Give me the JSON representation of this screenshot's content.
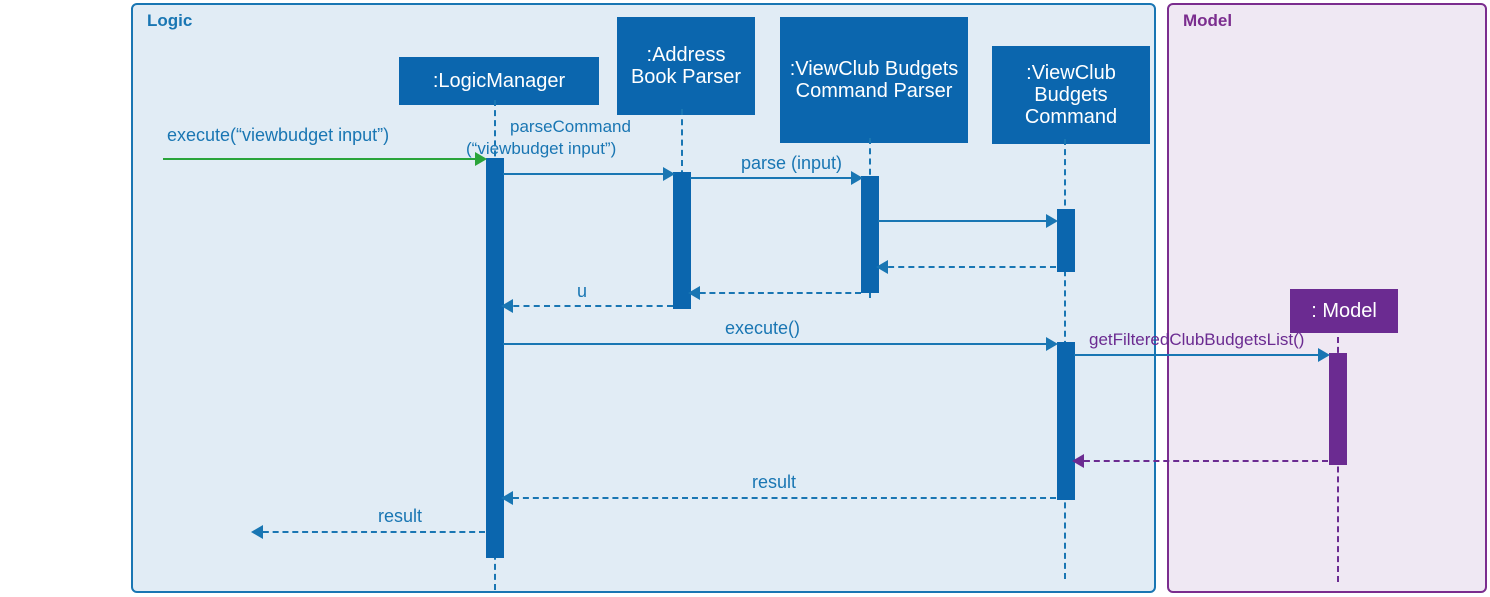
{
  "frames": {
    "logic": "Logic",
    "model": "Model"
  },
  "heads": {
    "logicManager": ":LogicManager",
    "addressBookParser": ":Address Book Parser",
    "viewClubBudgetsCommandParser": ":ViewClub Budgets Command Parser",
    "viewClubBudgetsCommand": ":ViewClub Budgets Command",
    "model": ": Model"
  },
  "messages": {
    "executeInput": "execute(“viewbudget input”)",
    "parseCommand1": "parseCommand",
    "parseCommand2": "(“viewbudget input”)",
    "parseInput": "parse (input)",
    "u": "u",
    "execute": "execute()",
    "getFiltered": "getFilteredClubBudgetsList()",
    "result1": "result",
    "result2": "result"
  }
}
